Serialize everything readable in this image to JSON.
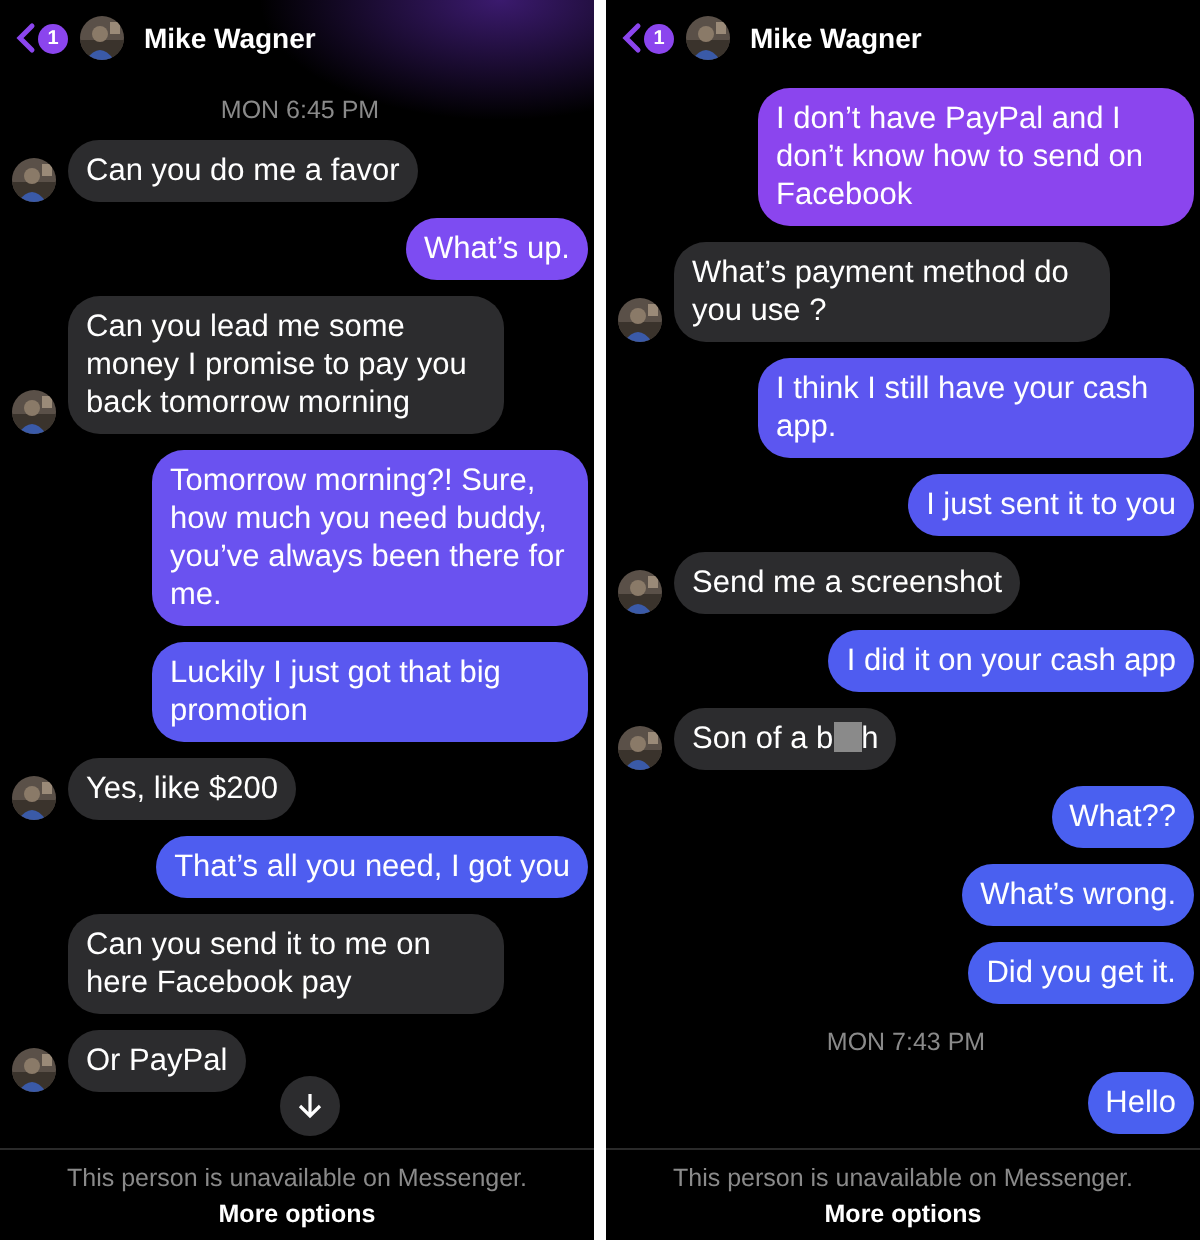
{
  "panels": [
    {
      "header": {
        "back_badge": "1",
        "name": "Mike Wagner"
      },
      "messages": [
        {
          "kind": "time",
          "text": "MON 6:45 PM"
        },
        {
          "kind": "in",
          "text": "Can you do me a favor",
          "avatar": true
        },
        {
          "kind": "out",
          "text": "What’s up.",
          "color": "#7d4cf2"
        },
        {
          "kind": "in",
          "text": "Can you lead me some money I promise to pay you back tomorrow morning",
          "avatar": true
        },
        {
          "kind": "out",
          "text": "Tomorrow morning?! Sure, how much you need buddy, you’ve always been there for me.",
          "color": "#6a52f0"
        },
        {
          "kind": "out",
          "text": "Luckily I just got that big promotion",
          "color": "#5a58f0"
        },
        {
          "kind": "in",
          "text": "Yes, like $200",
          "avatar": true
        },
        {
          "kind": "out",
          "text": "That’s all you need, I got you",
          "color": "#4e5df0"
        },
        {
          "kind": "in",
          "text": "Can you send it to me on here Facebook pay",
          "avatar": false
        },
        {
          "kind": "in",
          "text": "Or PayPal",
          "avatar": true
        }
      ],
      "scroll_down": true,
      "footer": {
        "notice": "This person is unavailable on Messenger.",
        "link": "More options"
      }
    },
    {
      "header": {
        "back_badge": "1",
        "name": "Mike Wagner"
      },
      "messages": [
        {
          "kind": "out",
          "text": "I don’t have PayPal and I don’t know how to send on Facebook",
          "color": "#8b45ee"
        },
        {
          "kind": "in",
          "text": "What’s payment method do you use ?",
          "avatar": true
        },
        {
          "kind": "out",
          "text": "I think I still have your cash app.",
          "color": "#5c56f0"
        },
        {
          "kind": "out",
          "text": "I just sent it to you",
          "color": "#5558f0"
        },
        {
          "kind": "in",
          "text": "Send me a screenshot",
          "avatar": true
        },
        {
          "kind": "out",
          "text": "I did it on your cash app",
          "color": "#4f5cf0"
        },
        {
          "kind": "censored",
          "parts": [
            "Son of a b",
            "h"
          ],
          "avatar": true
        },
        {
          "kind": "out",
          "text": "What??",
          "color": "#4a60f0"
        },
        {
          "kind": "out",
          "text": "What’s wrong.",
          "color": "#4a60f0"
        },
        {
          "kind": "out",
          "text": "Did you get it.",
          "color": "#4a60f0"
        },
        {
          "kind": "time",
          "text": "MON 7:43 PM"
        },
        {
          "kind": "out",
          "text": "Hello",
          "color": "#4a60f0"
        }
      ],
      "scroll_down": false,
      "footer": {
        "notice": "This person is unavailable on Messenger.",
        "link": "More options"
      }
    }
  ]
}
